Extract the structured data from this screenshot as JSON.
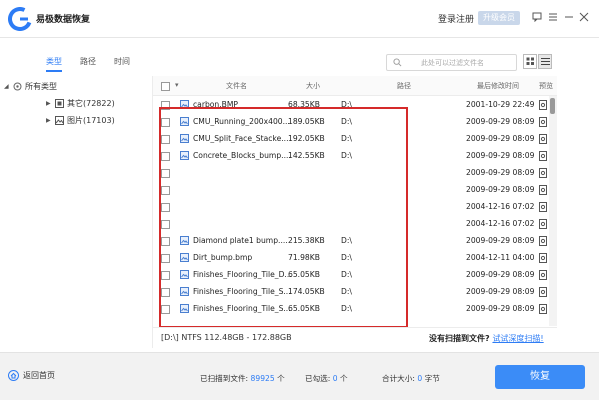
{
  "app": {
    "title": "易极数据恢复"
  },
  "header": {
    "login": "登录注册",
    "upgrade": "升级会员"
  },
  "tabs": [
    {
      "label": "类型",
      "active": true
    },
    {
      "label": "路径",
      "active": false
    },
    {
      "label": "时间",
      "active": false
    }
  ],
  "search": {
    "placeholder": "此处可以过滤文件名"
  },
  "tree": {
    "root": "所有类型",
    "items": [
      {
        "label": "其它(72822)"
      },
      {
        "label": "图片(17103)"
      }
    ]
  },
  "table": {
    "columns": [
      "文件名",
      "大小",
      "路径",
      "最后修改时间",
      "预览"
    ],
    "rows": [
      {
        "icon": "image-file-icon",
        "name": "carbon.BMP",
        "size": "68.35KB",
        "path": "D:\\",
        "time": "2001-10-29 22:49"
      },
      {
        "icon": "image-file-icon",
        "name": "CMU_Running_200x400...",
        "size": "189.05KB",
        "path": "D:\\",
        "time": "2009-09-29 08:09"
      },
      {
        "icon": "image-file-icon",
        "name": "CMU_Split_Face_Stacke...",
        "size": "192.05KB",
        "path": "D:\\",
        "time": "2009-09-29 08:09"
      },
      {
        "icon": "image-file-icon",
        "name": "Concrete_Blocks_bump....",
        "size": "142.55KB",
        "path": "D:\\",
        "time": "2009-09-29 08:09"
      },
      {
        "icon": "",
        "name": "",
        "size": "",
        "path": "",
        "time": "2009-09-29 08:09"
      },
      {
        "icon": "",
        "name": "",
        "size": "",
        "path": "",
        "time": "2009-09-29 08:09"
      },
      {
        "icon": "",
        "name": "",
        "size": "",
        "path": "",
        "time": "2004-12-16 07:02"
      },
      {
        "icon": "",
        "name": "",
        "size": "",
        "path": "",
        "time": "2004-12-16 07:02"
      },
      {
        "icon": "image-file-icon",
        "name": "Diamond plate1 bump....",
        "size": "215.38KB",
        "path": "D:\\",
        "time": "2009-09-29 08:09"
      },
      {
        "icon": "image-file-icon",
        "name": "Dirt_bump.bmp",
        "size": "71.98KB",
        "path": "D:\\",
        "time": "2004-12-11 04:00"
      },
      {
        "icon": "image-file-icon",
        "name": "Finishes_Flooring_Tile_D...",
        "size": "65.05KB",
        "path": "D:\\",
        "time": "2009-09-29 08:09"
      },
      {
        "icon": "image-file-icon",
        "name": "Finishes_Flooring_Tile_S...",
        "size": "174.05KB",
        "path": "D:\\",
        "time": "2009-09-29 08:09"
      },
      {
        "icon": "image-file-icon",
        "name": "Finishes_Flooring_Tile_S...",
        "size": "65.05KB",
        "path": "D:\\",
        "time": "2009-09-29 08:09"
      }
    ]
  },
  "status": {
    "disk": "[D:\\] NTFS 112.48GB - 172.88GB",
    "no_file": "没有扫描到文件?",
    "deep_scan": "试试深度扫描!"
  },
  "footer": {
    "home": "返回首页",
    "scanned_label": "已扫描到文件:",
    "scanned_count": "89925",
    "scanned_unit": "个",
    "checked_label": "已勾选:",
    "checked_count": "0",
    "checked_unit": "个",
    "total_label": "合计大小:",
    "total_size": "0",
    "total_unit": "字节",
    "recover": "恢复"
  },
  "colors": {
    "accent": "#3b8cf7",
    "highlight": "#d52a2a"
  }
}
